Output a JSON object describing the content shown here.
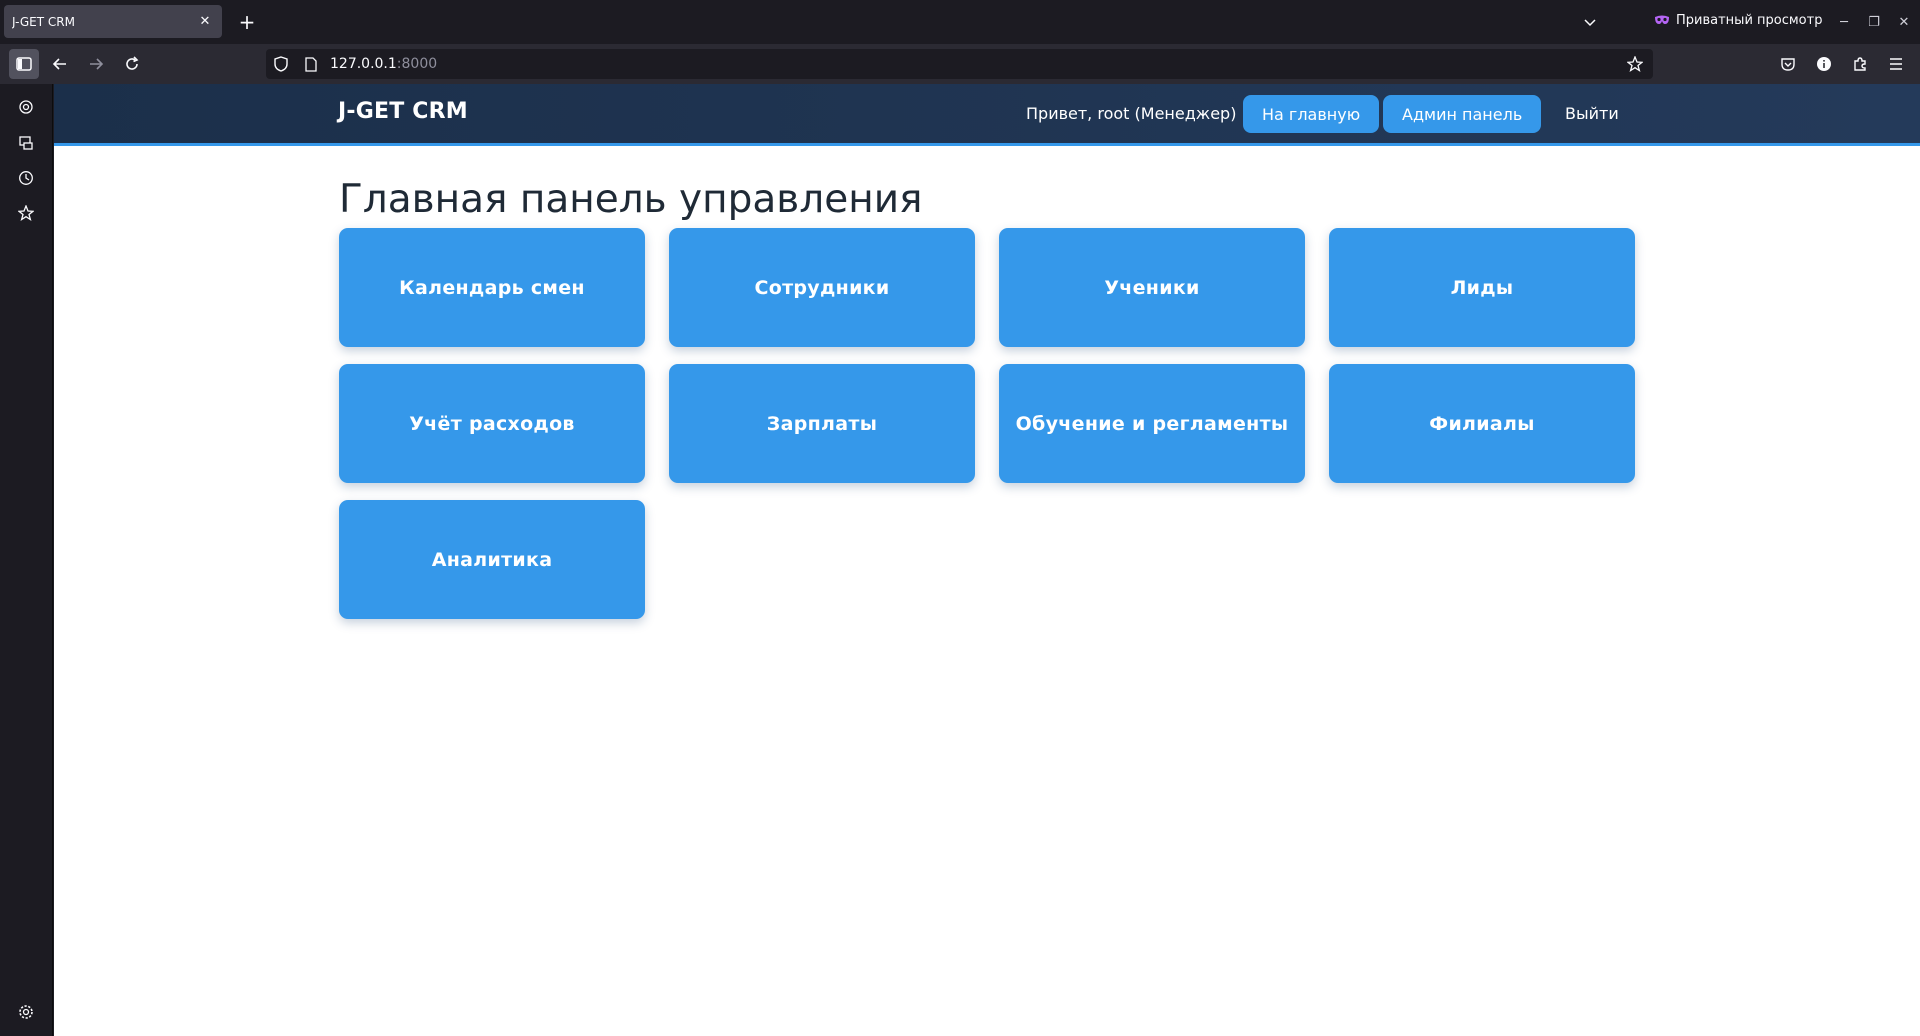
{
  "browser": {
    "tab_title": "J-GET CRM",
    "private_label": "Приватный просмотр",
    "url_host": "127.0.0.1",
    "url_port": ":8000"
  },
  "header": {
    "brand": "J-GET CRM",
    "greeting": "Привет, root (Менеджер)",
    "home_label": "На главную",
    "admin_label": "Админ панель",
    "logout_label": "Выйти"
  },
  "main": {
    "title": "Главная панель управления",
    "cards": [
      {
        "label": "Календарь смен"
      },
      {
        "label": "Сотрудники"
      },
      {
        "label": "Ученики"
      },
      {
        "label": "Лиды"
      },
      {
        "label": "Учёт расходов"
      },
      {
        "label": "Зарплаты"
      },
      {
        "label": "Обучение и регламенты"
      },
      {
        "label": "Филиалы"
      },
      {
        "label": "Аналитика"
      }
    ]
  },
  "colors": {
    "accent": "#3598ea",
    "header_bg": "#1b2f4a",
    "browser_bg": "#1c1b22"
  },
  "icons": [
    "sidebar-toggle-icon",
    "back-icon",
    "forward-icon",
    "reload-icon",
    "shield-icon",
    "page-icon",
    "bookmark-star-icon",
    "pocket-icon",
    "info-icon",
    "extensions-icon",
    "menu-icon",
    "ai-chatbot-icon",
    "synced-tabs-icon",
    "history-icon",
    "bookmarks-icon",
    "settings-icon",
    "private-mask-icon"
  ]
}
